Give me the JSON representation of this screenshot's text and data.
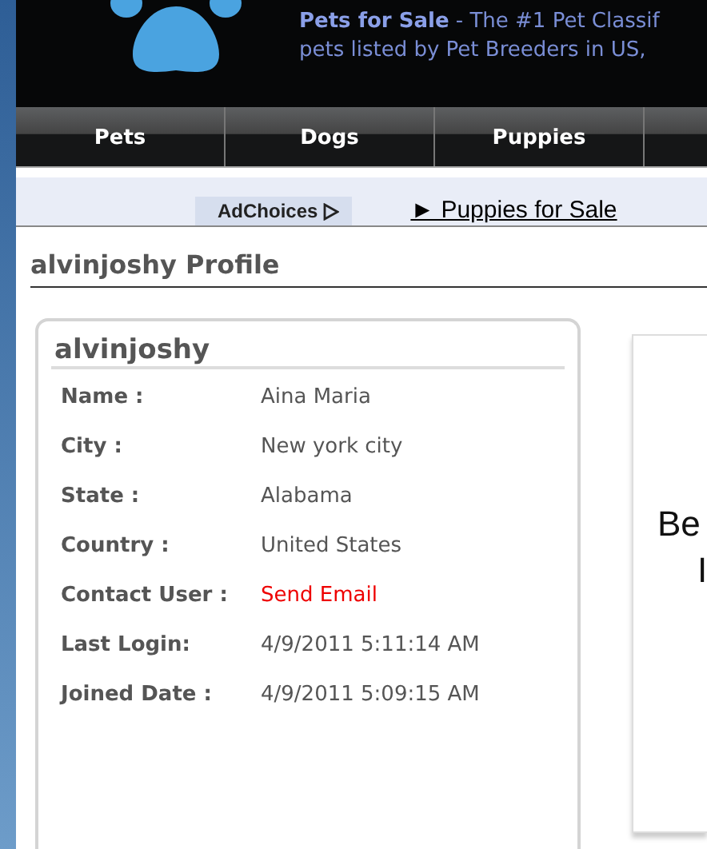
{
  "header": {
    "site_name": "Pets for Sale",
    "tagline": " - The #1 Pet Classif",
    "tagline_line2": "pets listed by Pet Breeders in US,"
  },
  "nav": [
    {
      "label": "Pets"
    },
    {
      "label": "Dogs"
    },
    {
      "label": "Puppies"
    }
  ],
  "ad_bar": {
    "adchoices": "AdChoices",
    "link": "► Puppies for Sale"
  },
  "page_title": "alvinjoshy Profile",
  "profile": {
    "username": "alvinjoshy",
    "fields": [
      {
        "label": "Name :",
        "value": "Aina Maria",
        "kind": "text"
      },
      {
        "label": "City :",
        "value": "New york city",
        "kind": "text"
      },
      {
        "label": "State :",
        "value": "Alabama",
        "kind": "text"
      },
      {
        "label": "Country :",
        "value": "United States",
        "kind": "text"
      },
      {
        "label": "Contact User :",
        "value": "Send Email",
        "kind": "link"
      },
      {
        "label": "Last Login:",
        "value": "4/9/2011 5:11:14 AM",
        "kind": "text"
      },
      {
        "label": "Joined Date :",
        "value": "4/9/2011 5:09:15 AM",
        "kind": "text"
      }
    ]
  },
  "side_box": {
    "line_1": "Be",
    "line_2": "I"
  }
}
